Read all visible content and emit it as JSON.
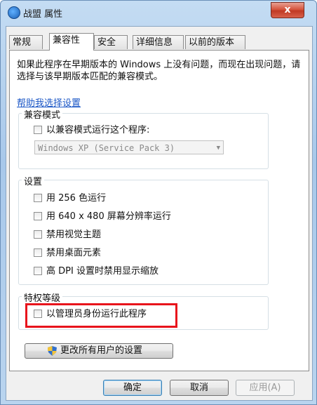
{
  "window": {
    "title": "战盟 属性",
    "close_label": "x"
  },
  "tabs": [
    {
      "label": "常规"
    },
    {
      "label": "兼容性"
    },
    {
      "label": "安全"
    },
    {
      "label": "详细信息"
    },
    {
      "label": "以前的版本"
    }
  ],
  "description": "如果此程序在早期版本的 Windows 上没有问题，而现在出现问题，请选择与该早期版本匹配的兼容模式。",
  "help_link": "帮助我选择设置",
  "compat_mode": {
    "title": "兼容模式",
    "checkbox_label": "以兼容模式运行这个程序:",
    "selected_os": "Windows XP (Service Pack 3)"
  },
  "settings": {
    "title": "设置",
    "items": [
      {
        "label": "用 256 色运行"
      },
      {
        "label": "用 640 x 480 屏幕分辨率运行"
      },
      {
        "label": "禁用视觉主题"
      },
      {
        "label": "禁用桌面元素"
      },
      {
        "label": "高 DPI 设置时禁用显示缩放"
      }
    ]
  },
  "privilege": {
    "title": "特权等级",
    "checkbox_label": "以管理员身份运行此程序"
  },
  "change_all_users_label": "更改所有用户的设置",
  "buttons": {
    "ok": "确定",
    "cancel": "取消",
    "apply": "应用(A)"
  },
  "colors": {
    "highlight": "#e8141c",
    "link": "#1a56c6"
  }
}
